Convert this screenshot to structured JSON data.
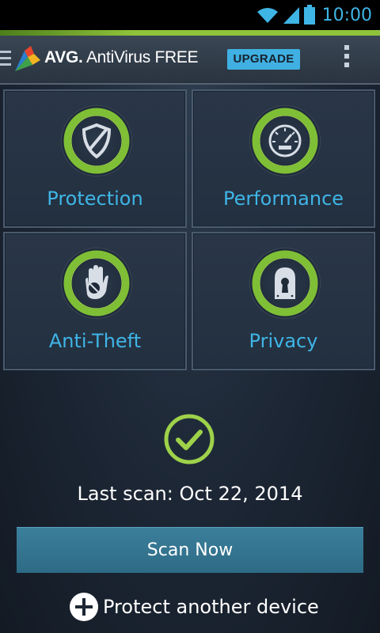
{
  "status_bar": {
    "time": "10:00",
    "icons": [
      "wifi-icon",
      "cell-signal-icon",
      "battery-icon"
    ]
  },
  "action_bar": {
    "brand": "AVG.",
    "product": " AntiVirus FREE",
    "upgrade_label": "UPGRADE",
    "nav_icon": "drawer-menu-icon",
    "overflow_icon": "overflow-menu-icon"
  },
  "tiles": [
    {
      "label": "Protection",
      "icon": "shield-icon"
    },
    {
      "label": "Performance",
      "icon": "speedometer-icon"
    },
    {
      "label": "Anti-Theft",
      "icon": "hand-stop-icon"
    },
    {
      "label": "Privacy",
      "icon": "keyhole-lock-icon"
    }
  ],
  "status": {
    "last_scan": "Last scan: Oct 22, 2014",
    "state_icon": "check-circle-icon"
  },
  "actions": {
    "scan_now": "Scan Now",
    "protect_another": "Protect another device"
  },
  "colors": {
    "accent_green": "#8ec23a",
    "accent_blue": "#3fb5e6",
    "upgrade_bg": "#40b0e2",
    "scan_button": "#3b7f9c",
    "background": "#1c2634"
  }
}
